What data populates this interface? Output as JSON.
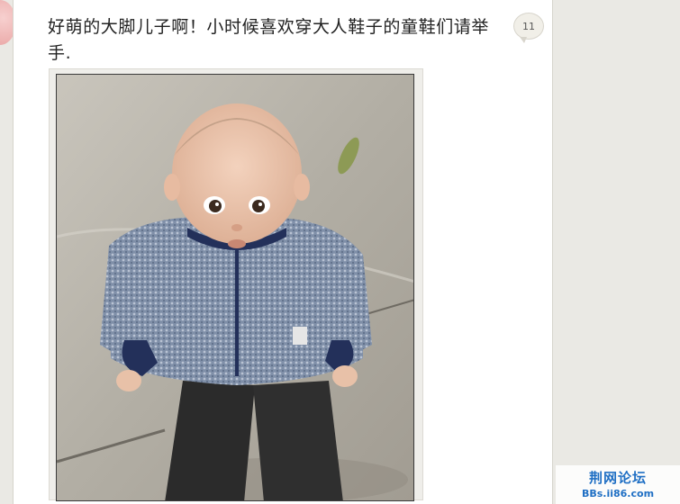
{
  "post": {
    "text": "好萌的大脚儿子啊！小时候喜欢穿大人鞋子的童鞋们请举手.",
    "reply_count": "11",
    "image_icon": "photo-baby-in-big-boots"
  },
  "watermark": {
    "title": "荆网论坛",
    "url": "BBs.ii86.com"
  },
  "colors": {
    "page_bg": "#eae9e4",
    "card_bg": "#ffffff",
    "watermark_blue": "#1f6fc4"
  }
}
